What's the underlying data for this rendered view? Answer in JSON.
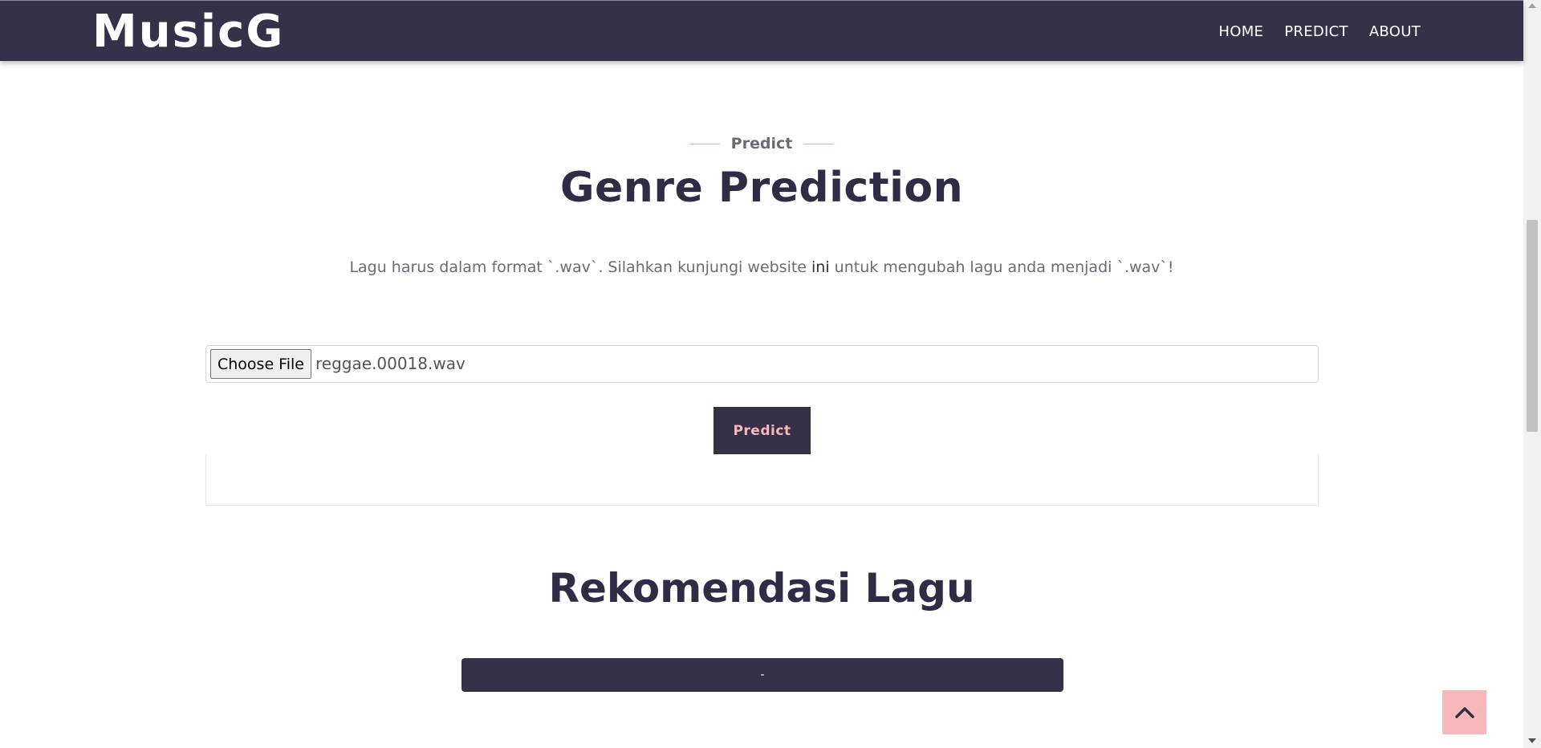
{
  "header": {
    "brand": "MusicG",
    "nav": [
      "HOME",
      "PREDICT",
      "ABOUT"
    ]
  },
  "section": {
    "eyebrow": "Predict",
    "title": "Genre Prediction",
    "desc_before": "Lagu harus dalam format `.wav`. Silahkan kunjungi website ",
    "desc_link": "ini",
    "desc_after": " untuk mengubah lagu anda menjadi `.wav`!"
  },
  "file_input": {
    "button_label": "Choose File",
    "file_name": "reggae.00018.wav"
  },
  "predict_button": "Predict",
  "recommendation": {
    "title": "Rekomendasi Lagu",
    "item": "-"
  },
  "colors": {
    "primary": "#353149",
    "accent": "#f6b8b8"
  }
}
